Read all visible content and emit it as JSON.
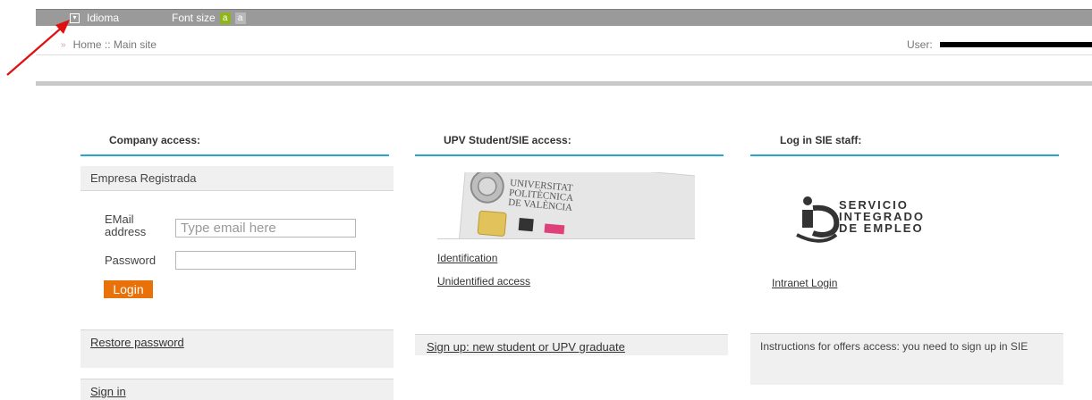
{
  "topbar": {
    "language_label": "Idioma",
    "font_size_label": "Font size",
    "font_small": "a",
    "font_large": "a"
  },
  "breadcrumb": {
    "text": "Home :: Main site"
  },
  "user": {
    "label": "User:"
  },
  "company": {
    "header": "Company access:",
    "registered_label": "Empresa Registrada",
    "email_label": "EMail address",
    "email_placeholder": "Type email here",
    "email_value": "",
    "password_label": "Password",
    "password_value": "",
    "login_label": "Login",
    "restore_password": "Restore password",
    "sign_in": "Sign in"
  },
  "student": {
    "header": "UPV Student/SIE access:",
    "card_text_1": "UNIVERSITAT",
    "card_text_2": "POLITÈCNICA",
    "card_text_3": "DE VALÈNCIA",
    "identification": "Identification",
    "unidentified": "Unidentified access",
    "sign_up": "Sign up: new student or UPV graduate"
  },
  "staff": {
    "header": "Log in SIE staff:",
    "logo_line_1": "SERVICIO",
    "logo_line_2": "INTEGRADO",
    "logo_line_3": "DE EMPLEO",
    "intranet": "Intranet Login",
    "instructions": "Instructions for offers access: you need to sign up in SIE"
  },
  "colors": {
    "accent_blue": "#27a5cf",
    "login_orange": "#e8710a",
    "font_small_green": "#8fb51b",
    "annotation_red": "#e01010"
  }
}
